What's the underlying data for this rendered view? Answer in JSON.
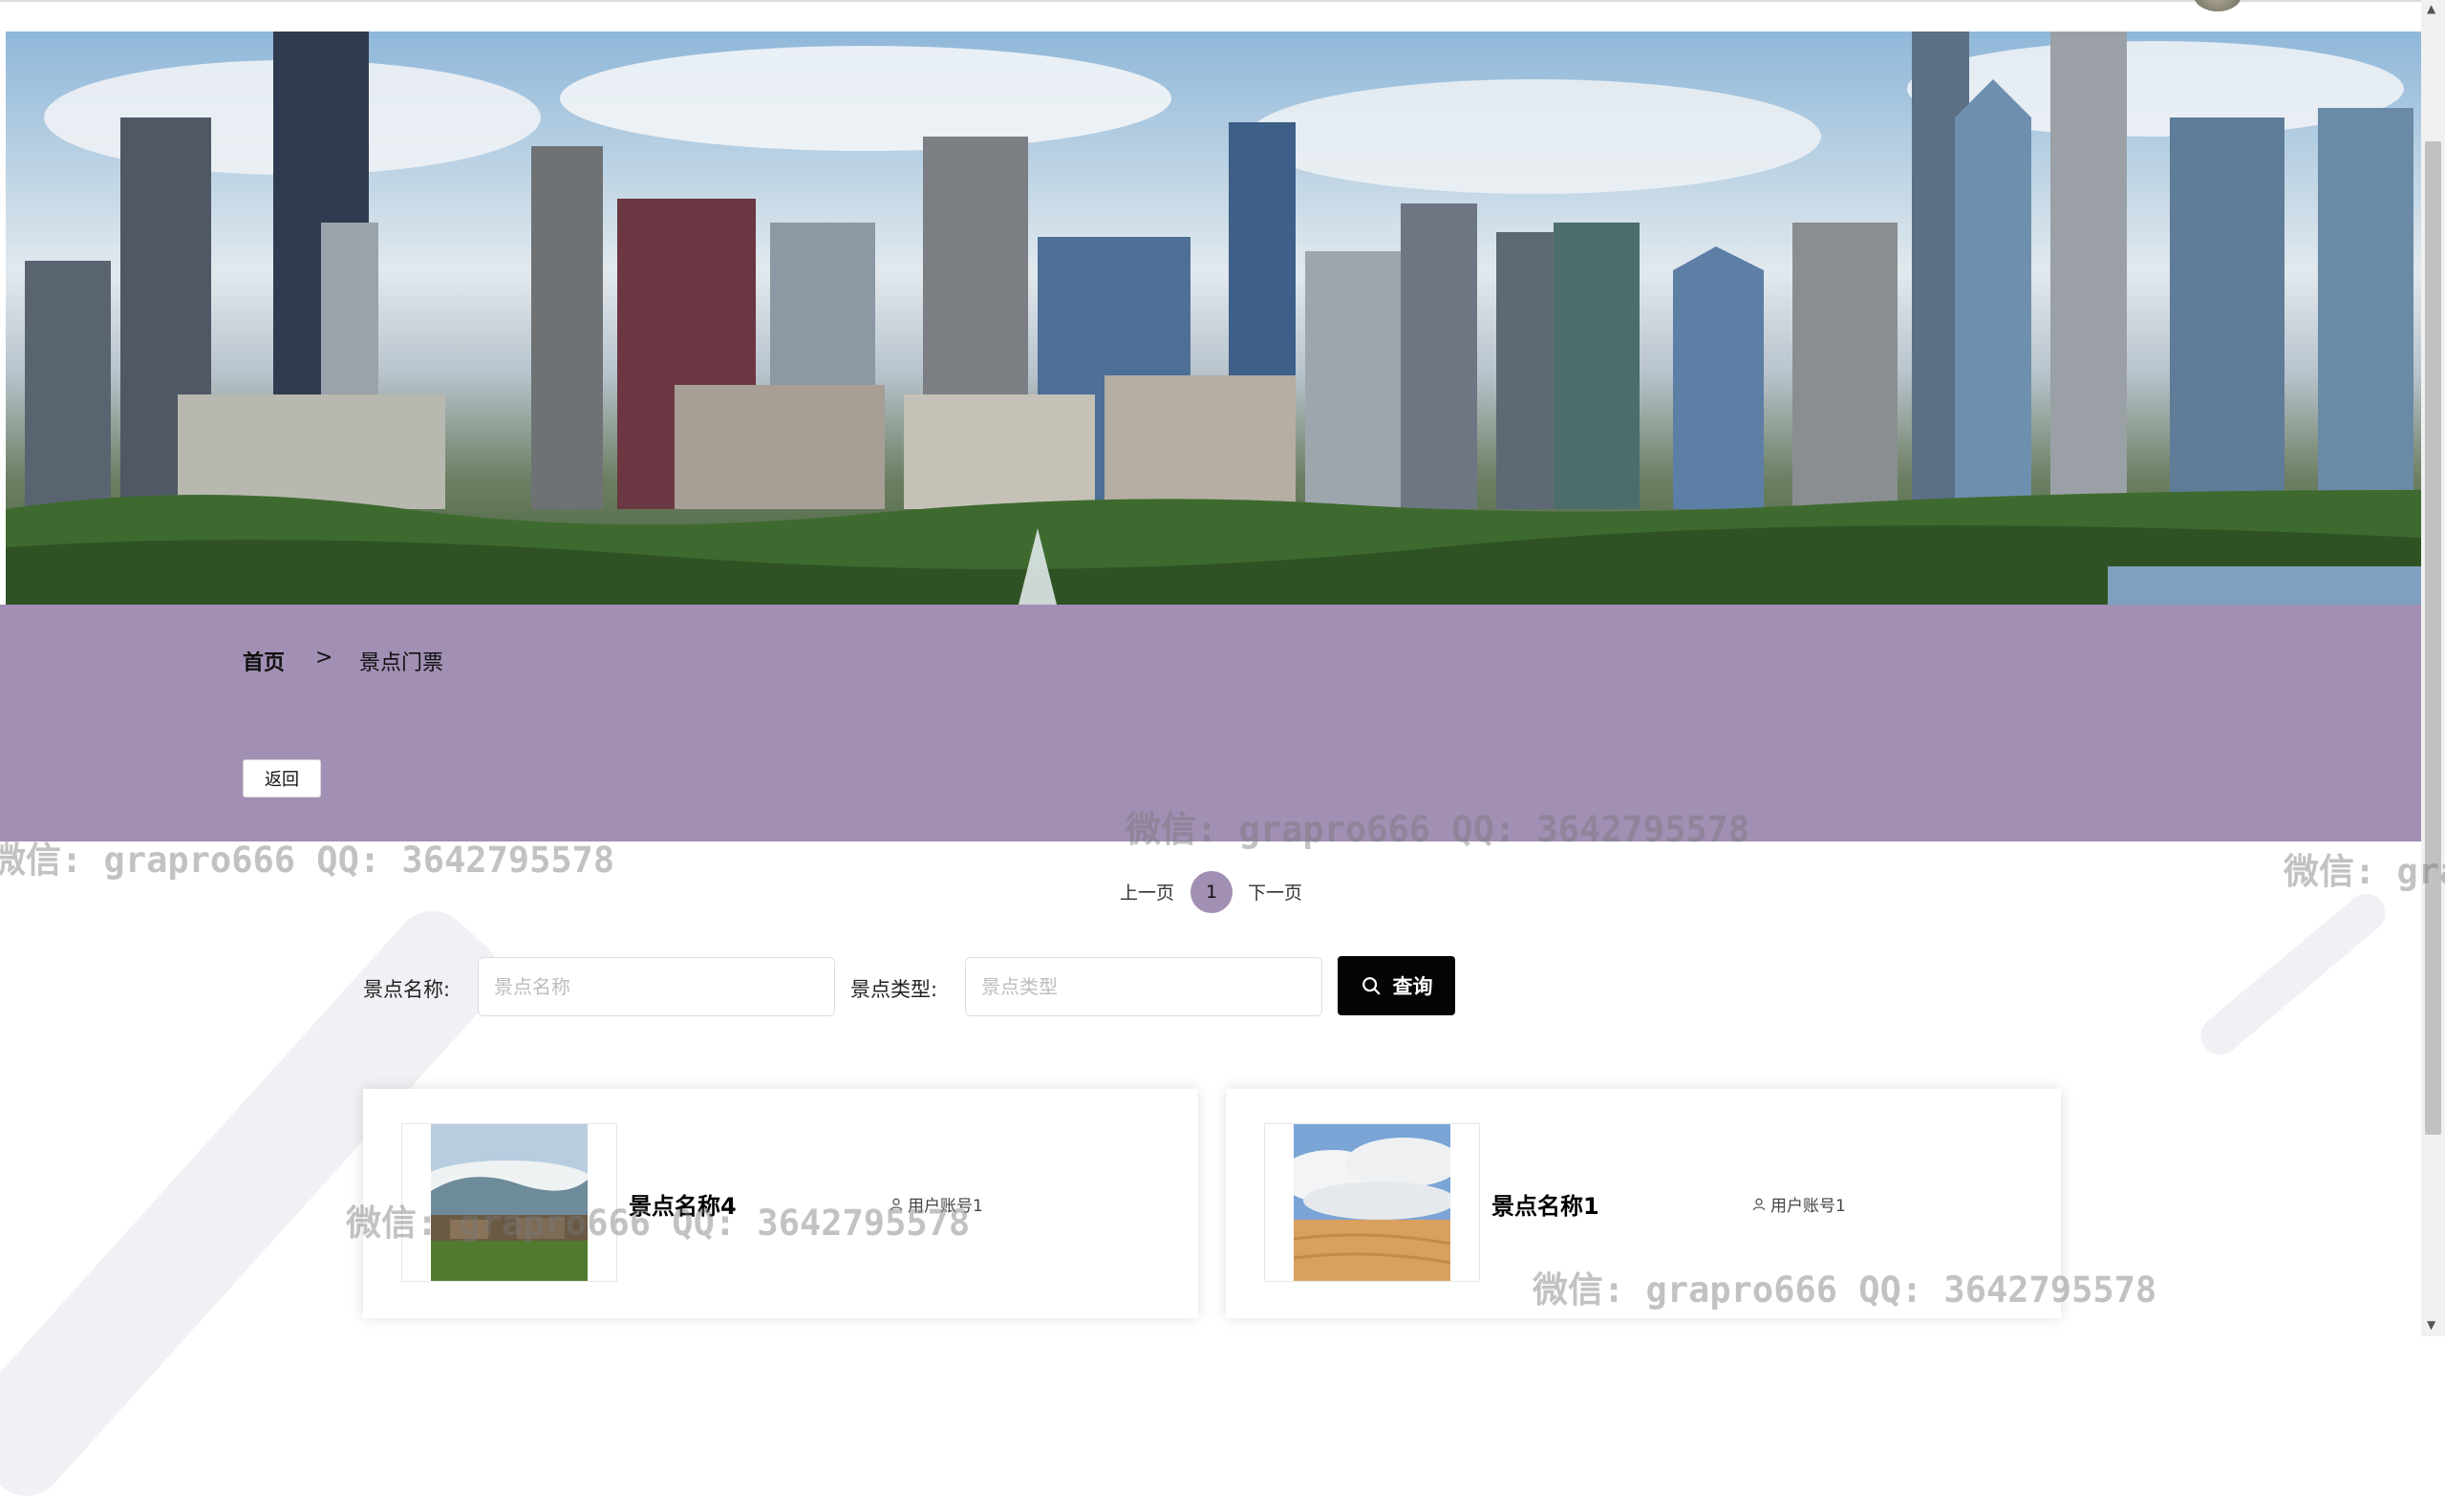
{
  "breadcrumb": {
    "home": "首页",
    "separator": ">",
    "current": "景点门票"
  },
  "back_button": "返回",
  "pagination": {
    "prev": "上一页",
    "current_page": "1",
    "next": "下一页"
  },
  "search": {
    "name_label": "景点名称:",
    "name_placeholder": "景点名称",
    "type_label": "景点类型:",
    "type_placeholder": "景点类型",
    "button_label": "查询"
  },
  "cards": [
    {
      "title": "景点名称4",
      "user": "用户账号1"
    },
    {
      "title": "景点名称1",
      "user": "用户账号1"
    }
  ],
  "watermark": "微信: grapro666 QQ: 3642795578",
  "colors": {
    "band": "#a28fb4",
    "search_button": "#050505",
    "page_active": "#a28fb4"
  },
  "icons": [
    "search-icon",
    "user-icon",
    "avatar"
  ]
}
